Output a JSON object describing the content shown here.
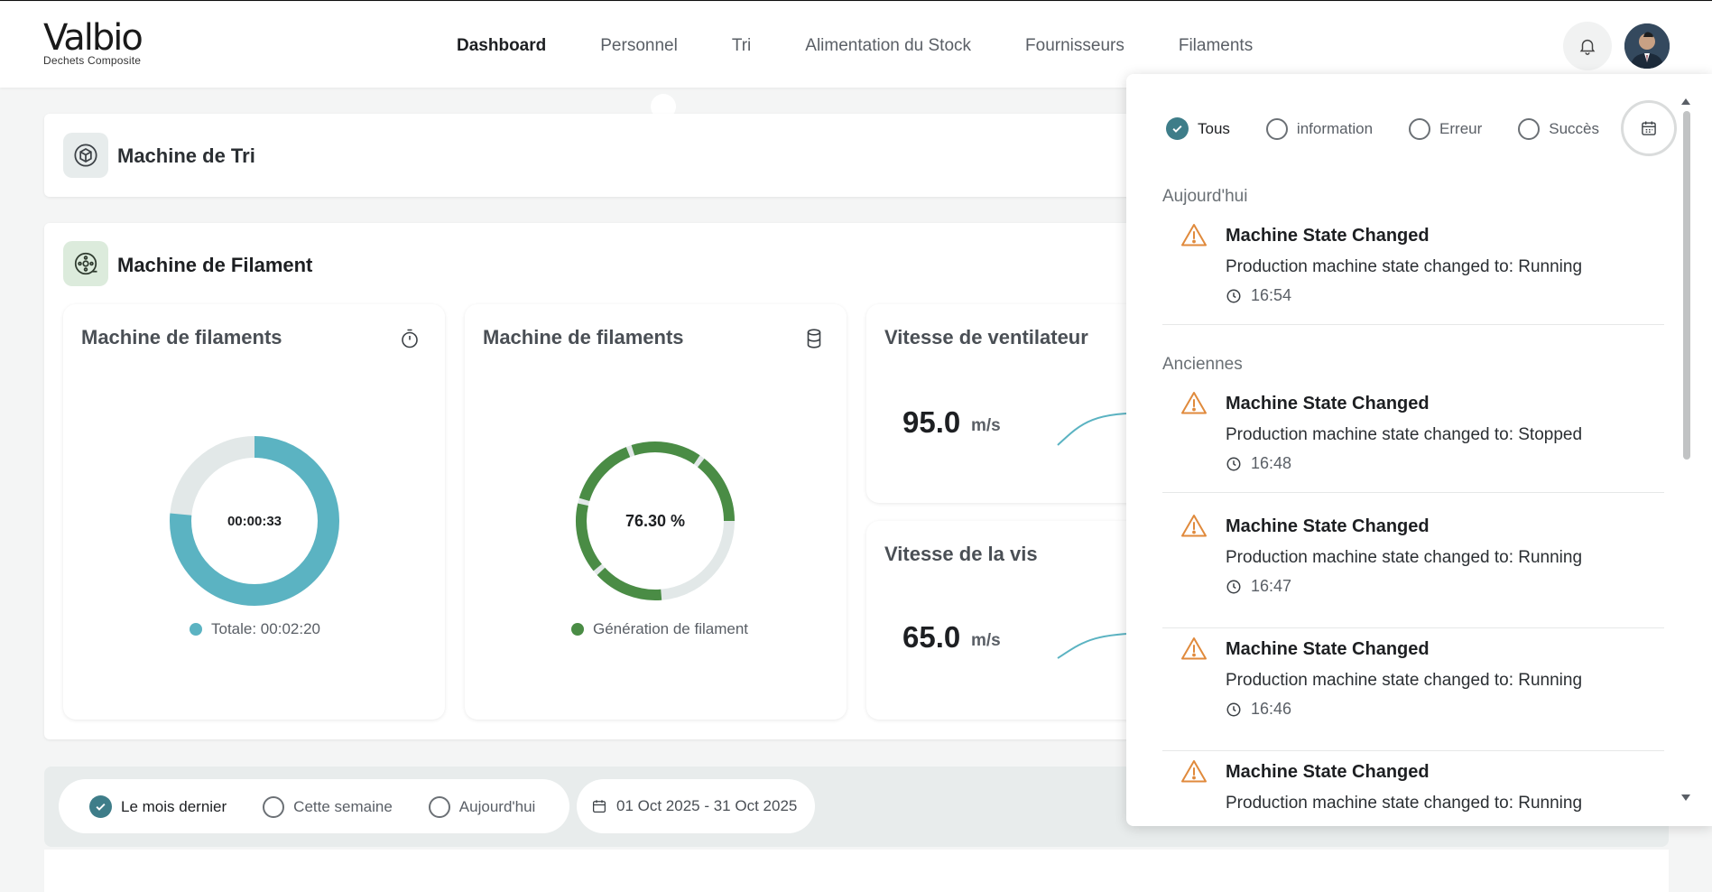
{
  "logo": {
    "name": "Valbio",
    "tagline": "Dechets Composite"
  },
  "nav": {
    "items": [
      "Dashboard",
      "Personnel",
      "Tri",
      "Alimentation du Stock",
      "Fournisseurs",
      "Filaments"
    ],
    "active": "Dashboard"
  },
  "header": {
    "bell_icon": "bell-icon",
    "avatar_icon": "user-avatar"
  },
  "sections": {
    "tri": {
      "title": "Machine de Tri",
      "icon": "box-icon"
    },
    "filament": {
      "title": "Machine de Filament",
      "icon": "spool-icon"
    }
  },
  "cards": {
    "timer": {
      "title": "Machine de filaments",
      "icon": "stopwatch-icon",
      "center": "00:00:33",
      "legend": "Totale: 00:02:20",
      "fraction": 0.764,
      "color": "#5bb3c2",
      "track": "#e2e8e8"
    },
    "generation": {
      "title": "Machine de filaments",
      "icon": "database-icon",
      "center": "76.30 %",
      "legend": "Génération de filament",
      "percent": 76.3,
      "color": "#4a8c45",
      "track": "#e2e8e8"
    },
    "fan": {
      "title": "Vitesse de ventilateur",
      "value": "95.0",
      "unit": "m/s"
    },
    "screw": {
      "title": "Vitesse de la vis",
      "value": "65.0",
      "unit": "m/s"
    }
  },
  "period_filter": {
    "options": [
      "Le mois dernier",
      "Cette semaine",
      "Aujourd'hui"
    ],
    "selected": "Le mois dernier",
    "date_range": "01 Oct 2025 - 31 Oct 2025"
  },
  "notifications": {
    "filters": [
      "Tous",
      "information",
      "Erreur",
      "Succès"
    ],
    "selected": "Tous",
    "today_label": "Aujourd'hui",
    "older_label": "Anciennes",
    "today": [
      {
        "title": "Machine State Changed",
        "message": "Production machine state changed to: Running",
        "time": "16:54"
      }
    ],
    "older": [
      {
        "title": "Machine State Changed",
        "message": "Production machine state changed to: Stopped",
        "time": "16:48"
      },
      {
        "title": "Machine State Changed",
        "message": "Production machine state changed to: Running",
        "time": "16:47"
      },
      {
        "title": "Machine State Changed",
        "message": "Production machine state changed to: Running",
        "time": "16:46"
      },
      {
        "title": "Machine State Changed",
        "message": "Production machine state changed to: Running",
        "time": ""
      }
    ]
  },
  "colors": {
    "accent": "#3e7d89",
    "warning": "#e08a3c",
    "teal": "#5bb3c2",
    "green": "#4a8c45"
  }
}
